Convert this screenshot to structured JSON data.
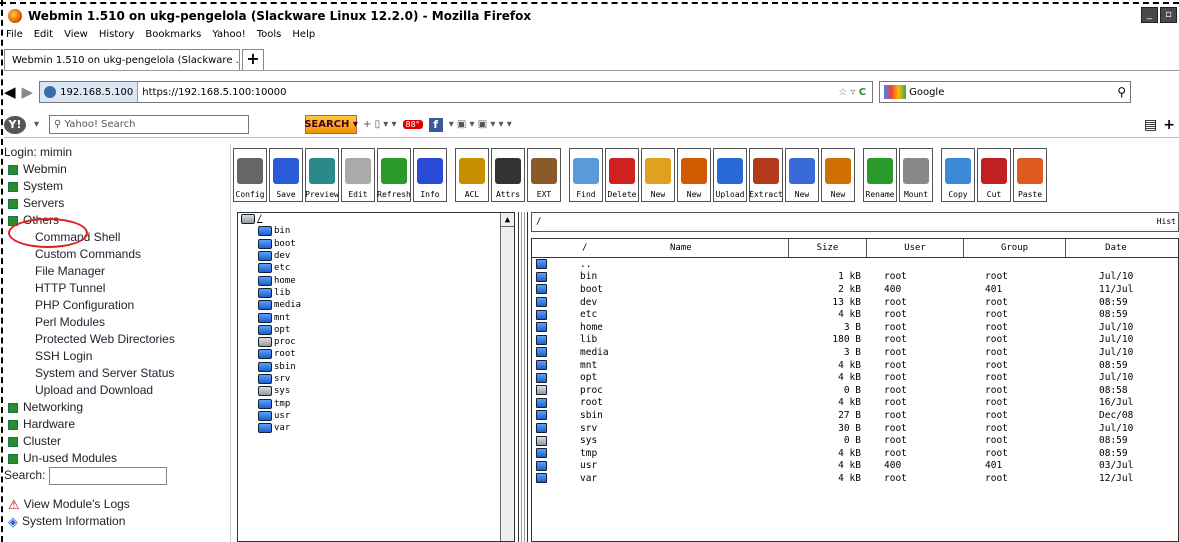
{
  "window": {
    "title": "Webmin 1.510 on ukg-pengelola (Slackware Linux 12.2.0) - Mozilla Firefox"
  },
  "menu": [
    "File",
    "Edit",
    "View",
    "History",
    "Bookmarks",
    "Yahoo!",
    "Tools",
    "Help"
  ],
  "tab": {
    "label": "Webmin 1.510 on ukg-pengelola (Slackware ...",
    "new_tab": "+"
  },
  "nav": {
    "site": "192.168.5.100",
    "url": "https://192.168.5.100:10000",
    "search_engine": "Google"
  },
  "yahoo": {
    "search_placeholder": "Yahoo! Search",
    "search_button": "SEARCH",
    "badge": "88°"
  },
  "sidebar": {
    "login": "Login: mimin",
    "categories": [
      {
        "label": "Webmin"
      },
      {
        "label": "System"
      },
      {
        "label": "Servers"
      },
      {
        "label": "Others"
      }
    ],
    "others_items": [
      "Command Shell",
      "Custom Commands",
      "File Manager",
      "HTTP Tunnel",
      "PHP Configuration",
      "Perl Modules",
      "Protected Web Directories",
      "SSH Login",
      "System and Server Status",
      "Upload and Download"
    ],
    "categories2": [
      {
        "label": "Networking"
      },
      {
        "label": "Hardware"
      },
      {
        "label": "Cluster"
      },
      {
        "label": "Un-used Modules"
      }
    ],
    "search_label": "Search:",
    "logs_label": "View Module's Logs",
    "sysinfo_label": "System Information"
  },
  "toolbar": [
    "Config",
    "Save",
    "Preview",
    "Edit",
    "Refresh",
    "Info",
    "ACL",
    "Attrs",
    "EXT",
    "Find",
    "Delete",
    "New",
    "New",
    "Upload",
    "Extract",
    "New",
    "New",
    "Rename",
    "Mount",
    "Copy",
    "Cut",
    "Paste"
  ],
  "toolbar_colors": [
    "#666",
    "#2a5ad8",
    "#2a8a8a",
    "#aaa",
    "#2a9a2a",
    "#2a4ad8",
    "#c89000",
    "#333",
    "#8a5a2a",
    "#5a9ad8",
    "#d02020",
    "#e0a020",
    "#d05a00",
    "#2a6ad8",
    "#b03a1a",
    "#3a6ad8",
    "#d07000",
    "#2a9a2a",
    "#888",
    "#3a8ad8",
    "#c02020",
    "#e05a20"
  ],
  "tree": {
    "root": "/",
    "folders": [
      {
        "name": "bin",
        "gray": false
      },
      {
        "name": "boot",
        "gray": false
      },
      {
        "name": "dev",
        "gray": false
      },
      {
        "name": "etc",
        "gray": false
      },
      {
        "name": "home",
        "gray": false
      },
      {
        "name": "lib",
        "gray": false
      },
      {
        "name": "media",
        "gray": false
      },
      {
        "name": "mnt",
        "gray": false
      },
      {
        "name": "opt",
        "gray": false
      },
      {
        "name": "proc",
        "gray": true
      },
      {
        "name": "root",
        "gray": false
      },
      {
        "name": "sbin",
        "gray": false
      },
      {
        "name": "srv",
        "gray": false
      },
      {
        "name": "sys",
        "gray": true
      },
      {
        "name": "tmp",
        "gray": false
      },
      {
        "name": "usr",
        "gray": false
      },
      {
        "name": "var",
        "gray": false
      }
    ]
  },
  "path": {
    "value": "/",
    "history_label": "Hist"
  },
  "table": {
    "headers": {
      "path": "/",
      "name": "Name",
      "size": "Size",
      "user": "User",
      "group": "Group",
      "date": "Date"
    },
    "rows": [
      {
        "name": "..",
        "size": "",
        "user": "",
        "group": "",
        "date": "",
        "gray": false
      },
      {
        "name": "bin",
        "size": "1 kB",
        "user": "root",
        "group": "root",
        "date": "Jul/10",
        "gray": false
      },
      {
        "name": "boot",
        "size": "2 kB",
        "user": "400",
        "group": "401",
        "date": "11/Jul",
        "gray": false
      },
      {
        "name": "dev",
        "size": "13 kB",
        "user": "root",
        "group": "root",
        "date": "08:59",
        "gray": false
      },
      {
        "name": "etc",
        "size": "4 kB",
        "user": "root",
        "group": "root",
        "date": "08:59",
        "gray": false
      },
      {
        "name": "home",
        "size": "3 B",
        "user": "root",
        "group": "root",
        "date": "Jul/10",
        "gray": false
      },
      {
        "name": "lib",
        "size": "180 B",
        "user": "root",
        "group": "root",
        "date": "Jul/10",
        "gray": false
      },
      {
        "name": "media",
        "size": "3 B",
        "user": "root",
        "group": "root",
        "date": "Jul/10",
        "gray": false
      },
      {
        "name": "mnt",
        "size": "4 kB",
        "user": "root",
        "group": "root",
        "date": "08:59",
        "gray": false
      },
      {
        "name": "opt",
        "size": "4 kB",
        "user": "root",
        "group": "root",
        "date": "Jul/10",
        "gray": false
      },
      {
        "name": "proc",
        "size": "0 B",
        "user": "root",
        "group": "root",
        "date": "08:58",
        "gray": true
      },
      {
        "name": "root",
        "size": "4 kB",
        "user": "root",
        "group": "root",
        "date": "16/Jul",
        "gray": false
      },
      {
        "name": "sbin",
        "size": "27 B",
        "user": "root",
        "group": "root",
        "date": "Dec/08",
        "gray": false
      },
      {
        "name": "srv",
        "size": "30 B",
        "user": "root",
        "group": "root",
        "date": "Jul/10",
        "gray": false
      },
      {
        "name": "sys",
        "size": "0 B",
        "user": "root",
        "group": "root",
        "date": "08:59",
        "gray": true
      },
      {
        "name": "tmp",
        "size": "4 kB",
        "user": "root",
        "group": "root",
        "date": "08:59",
        "gray": false
      },
      {
        "name": "usr",
        "size": "4 kB",
        "user": "400",
        "group": "401",
        "date": "03/Jul",
        "gray": false
      },
      {
        "name": "var",
        "size": "4 kB",
        "user": "root",
        "group": "root",
        "date": "12/Jul",
        "gray": false
      }
    ]
  }
}
